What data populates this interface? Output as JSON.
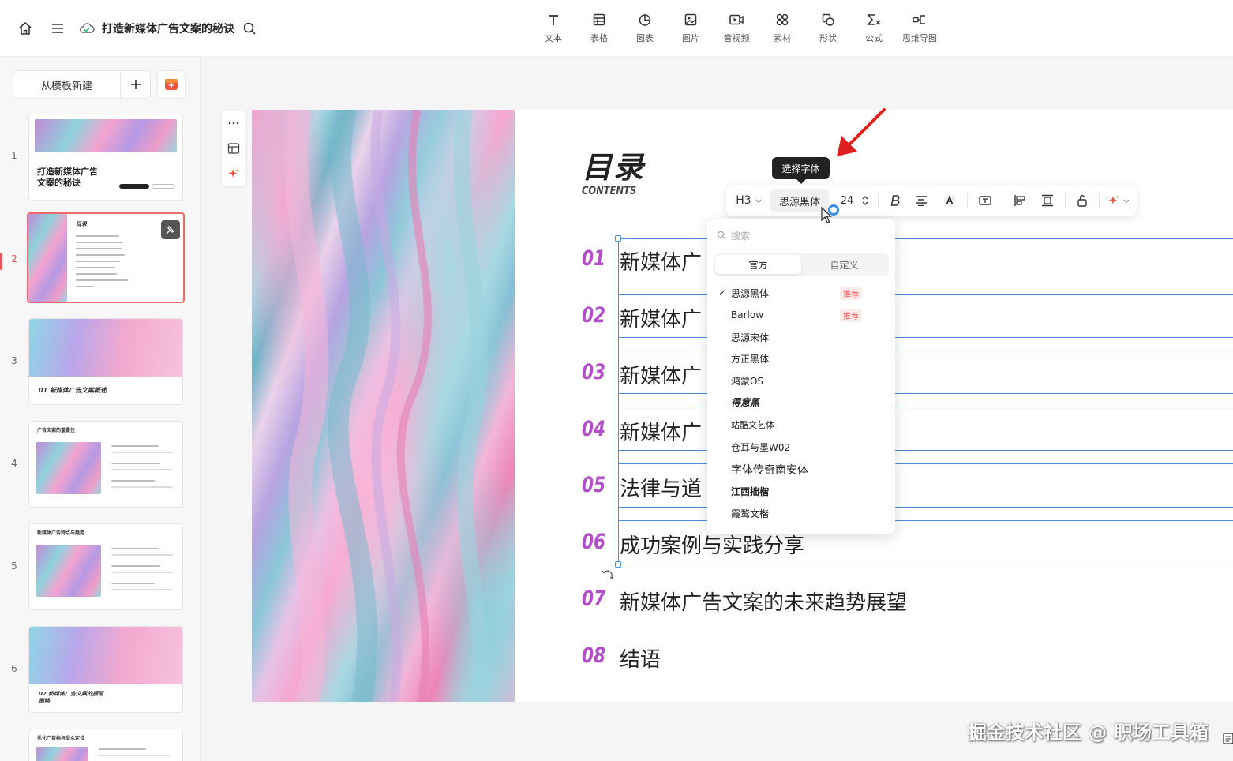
{
  "header": {
    "title": "打造新媒体广告文案的秘诀",
    "tools": [
      {
        "label": "文本",
        "icon": "text-icon"
      },
      {
        "label": "表格",
        "icon": "table-icon"
      },
      {
        "label": "图表",
        "icon": "chart-icon"
      },
      {
        "label": "图片",
        "icon": "image-icon"
      },
      {
        "label": "音视频",
        "icon": "video-icon"
      },
      {
        "label": "素材",
        "icon": "assets-icon"
      },
      {
        "label": "形状",
        "icon": "shape-icon"
      },
      {
        "label": "公式",
        "icon": "formula-icon"
      },
      {
        "label": "思维导图",
        "icon": "mindmap-icon"
      }
    ]
  },
  "sidebar": {
    "new_from_template": "从模板新建",
    "slides": [
      {
        "num": "1",
        "title": "打造新媒体广告\n文案的秘诀"
      },
      {
        "num": "2",
        "title": "目录"
      },
      {
        "num": "3",
        "title": "01 新媒体广告文案概述"
      },
      {
        "num": "4",
        "title": "广告文案的重要性"
      },
      {
        "num": "5",
        "title": "新媒体广告特点与趋势"
      },
      {
        "num": "6",
        "title": "02 新媒体广告文案的撰写\n策略"
      },
      {
        "num": "7",
        "title": "优化广告标与受众定位"
      }
    ]
  },
  "slide": {
    "title": "目录",
    "subtitle": "CONTENTS",
    "toc": [
      {
        "num": "01",
        "text": "新媒体广"
      },
      {
        "num": "02",
        "text": "新媒体广"
      },
      {
        "num": "03",
        "text": "新媒体广"
      },
      {
        "num": "04",
        "text": "新媒体广"
      },
      {
        "num": "05",
        "text": "法律与道"
      },
      {
        "num": "06",
        "text": "成功案例与实践分享"
      },
      {
        "num": "07",
        "text": "新媒体广告文案的未来趋势展望"
      },
      {
        "num": "08",
        "text": "结语"
      }
    ]
  },
  "format_bar": {
    "heading": "H3",
    "font": "思源黑体",
    "size": "24"
  },
  "tooltip": "选择字体",
  "font_dropdown": {
    "search_placeholder": "搜索",
    "tabs": [
      "官方",
      "自定义"
    ],
    "active_tab": "官方",
    "fonts": [
      {
        "name": "思源黑体",
        "checked": "✓",
        "tag": "推荐"
      },
      {
        "name": "Barlow",
        "checked": "",
        "tag": "推荐"
      },
      {
        "name": "思源宋体",
        "checked": "",
        "tag": ""
      },
      {
        "name": "方正黑体",
        "checked": "",
        "tag": ""
      },
      {
        "name": "鸿蒙OS",
        "checked": "",
        "tag": ""
      },
      {
        "name": "得意黑",
        "checked": "",
        "tag": ""
      },
      {
        "name": "站酷文艺体",
        "checked": "",
        "tag": ""
      },
      {
        "name": "仓耳与墨W02",
        "checked": "",
        "tag": ""
      },
      {
        "name": "字体传奇南安体",
        "checked": "",
        "tag": ""
      },
      {
        "name": "江西拙楷",
        "checked": "",
        "tag": ""
      },
      {
        "name": "霞鹜文楷",
        "checked": "",
        "tag": ""
      }
    ]
  },
  "watermark": "掘金技术社区 @ 职场工具箱",
  "colors": {
    "accent": "#b24fc8",
    "selection": "#4a90d9",
    "selected_slide": "#ec6a6a",
    "arrow": "#e02020"
  }
}
